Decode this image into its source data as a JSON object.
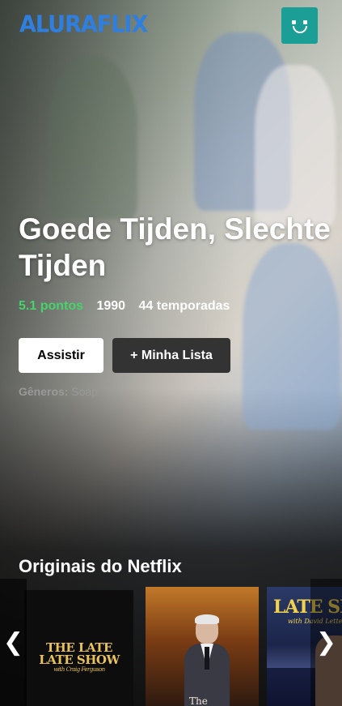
{
  "header": {
    "logo": "ALURAFLIX",
    "avatar_icon": "profile-smiley-icon",
    "avatar_color": "#1a9e96"
  },
  "featured": {
    "title": "Goede Tijden, Slechte Tijden",
    "points": "5.1 pontos",
    "year": "1990",
    "seasons": "44 temporadas",
    "watch_label": "Assistir",
    "mylist_label": "+ Minha Lista",
    "genres_label": "Gêneros:",
    "genres_value": "Soap"
  },
  "row": {
    "title": "Originais do Netflix",
    "left_arrow_icon": "chevron-left-icon",
    "right_arrow_icon": "chevron-right-icon",
    "posters": [
      {
        "title": "THE LATE LATE SHOW",
        "subtitle": "with Craig Ferguson"
      },
      {
        "caption": "The"
      },
      {
        "title": "LATE SH",
        "subtitle": "with David Letter"
      }
    ]
  },
  "colors": {
    "background": "#111111",
    "logo": "#2e7fe0",
    "points": "#46d369",
    "watch_button": "#ffffff",
    "list_button": "#333333"
  }
}
